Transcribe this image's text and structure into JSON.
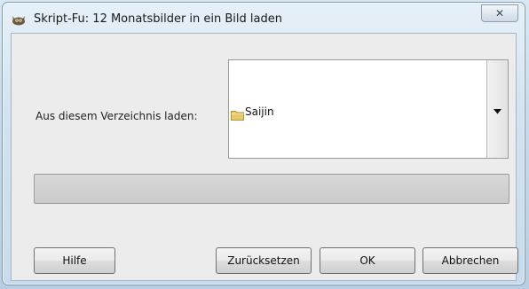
{
  "window": {
    "title": "Skript-Fu: 12 Monatsbilder in ein Bild laden",
    "icon": "gimp-wilber-icon",
    "close_glyph": "✕"
  },
  "form": {
    "directory_label": "Aus diesem Verzeichnis laden:",
    "directory_value": "Saijin",
    "directory_icon": "folder-icon",
    "dropdown_icon": "dropdown-arrow-icon"
  },
  "progress": {
    "value": 0
  },
  "buttons": {
    "help": "Hilfe",
    "reset": "Zurücksetzen",
    "ok": "OK",
    "cancel": "Abbrechen"
  },
  "colors": {
    "title_bar": "#d3e2ef",
    "client_bg": "#ececec",
    "folder": "#e8c96a"
  }
}
